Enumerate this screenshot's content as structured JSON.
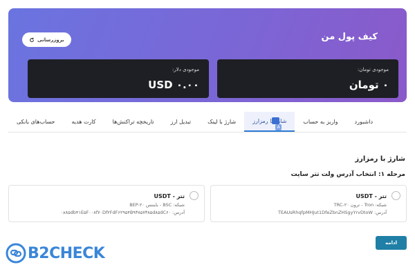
{
  "wallet": {
    "title": "کیف پول من",
    "refresh_label": "بروزرسانی",
    "toman": {
      "label": "موجودی تومان:",
      "value": "۰ تومان"
    },
    "usd": {
      "label": "موجودی دلار:",
      "value": "USD ۰.۰۰"
    },
    "colors": {
      "gradient_start": "#6a74e0",
      "gradient_end": "#8b59c9",
      "box": "#1e1f24"
    }
  },
  "tabs": [
    {
      "label": "داشبورد"
    },
    {
      "label": "واریز به حساب"
    },
    {
      "label": "شارژ با رمزارز"
    },
    {
      "label": "شارژ با لینک"
    },
    {
      "label": "تبدیل ارز"
    },
    {
      "label": "تاریخچه تراکنش‌ها"
    },
    {
      "label": "کارت هدیه"
    },
    {
      "label": "حساب‌های بانکی"
    }
  ],
  "active_tab": "شارژ با رمزارز",
  "content": {
    "section_title": "شارژ با رمزارز",
    "step_title": "مرحله ۱: انتخاب آدرس ولت تتر سایت",
    "options": [
      {
        "name": "تتر - USDT",
        "network": "شبکه: Tron - ترون TRC-۲۰",
        "address": "آدرس: TEAUsRhqfpMHJut1DfeZbnZHSgyYrvDtoW"
      },
      {
        "name": "تتر - USDT",
        "network": "شبکه: BSC - بایننس BEP-۲۰",
        "address": "آدرس: ۰x۸۵db۴۱E۵F۰۰۸f۷۰Df۲FdF۶۲۹۵۴B۹۳۸۵۷۳۸۵d۸۵dC۶۰"
      }
    ],
    "continue_label": "ادامه"
  },
  "watermark": {
    "text": "B2CHECK",
    "color": "#3a86d8"
  }
}
